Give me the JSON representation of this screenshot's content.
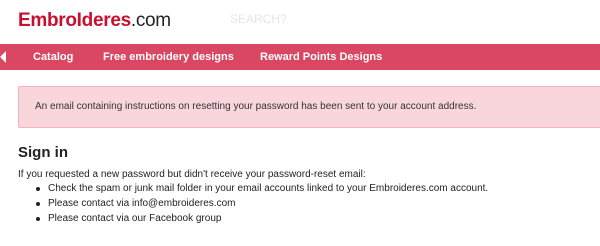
{
  "header": {
    "logo_part1": "EmbroIderеs",
    "logo_part2": ".com",
    "search_placeholder": "SEARCH?"
  },
  "nav": {
    "home_icon": "home-icon",
    "items": [
      {
        "label": "Catalog"
      },
      {
        "label": "Free embroidery designs"
      },
      {
        "label": "Reward Points Designs"
      }
    ]
  },
  "alert": {
    "message": "An email containing instructions on resetting your password has been sent to your account address."
  },
  "signin": {
    "title": "Sign in",
    "intro": "If you requested a new password but didn't receive your password-reset email:",
    "tips": {
      "tip1": "Check the spam or junk mail folder in your email accounts linked to your Embroideres.com account.",
      "tip2_prefix": "Please contact via ",
      "tip2_link": "info@embroideres.com",
      "tip3_prefix": "Please contact via our ",
      "tip3_link": "Facebook group"
    }
  },
  "colors": {
    "brand_red": "#c8102e",
    "nav_bg": "#d94763",
    "alert_bg": "#f9d6dc"
  }
}
